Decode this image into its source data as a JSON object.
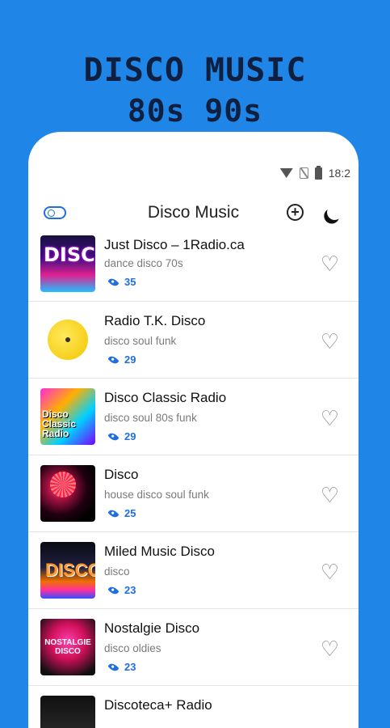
{
  "promo": {
    "line1": "DISCO MUSIC",
    "line2": "80s 90s"
  },
  "status": {
    "time": "18:2"
  },
  "appbar": {
    "title": "Disco Music"
  },
  "stations": [
    {
      "name": "Just Disco – 1Radio.ca",
      "tags": "dance disco 70s",
      "views": "35",
      "thumb_text": "DISCO"
    },
    {
      "name": "Radio T.K. Disco",
      "tags": "disco soul funk",
      "views": "29"
    },
    {
      "name": "Disco Classic Radio",
      "tags": "disco soul 80s funk",
      "views": "29",
      "thumb_text": "Disco Classic Radio"
    },
    {
      "name": "Disco",
      "tags": "house disco soul funk",
      "views": "25"
    },
    {
      "name": "Miled Music Disco",
      "tags": "disco",
      "views": "23",
      "thumb_text": "DISCO"
    },
    {
      "name": "Nostalgie Disco",
      "tags": "disco oldies",
      "views": "23",
      "thumb_text": "NOSTALGIE DISCO"
    },
    {
      "name": "Discoteca+ Radio",
      "tags": "",
      "views": ""
    }
  ],
  "colors": {
    "background": "#1f86e8",
    "accent": "#1f6fe0"
  },
  "icons": {
    "toggle": "toggle-icon",
    "add": "add-circle-icon",
    "theme": "moon-icon",
    "views": "eye-icon",
    "favorite": "heart-outline-icon"
  }
}
